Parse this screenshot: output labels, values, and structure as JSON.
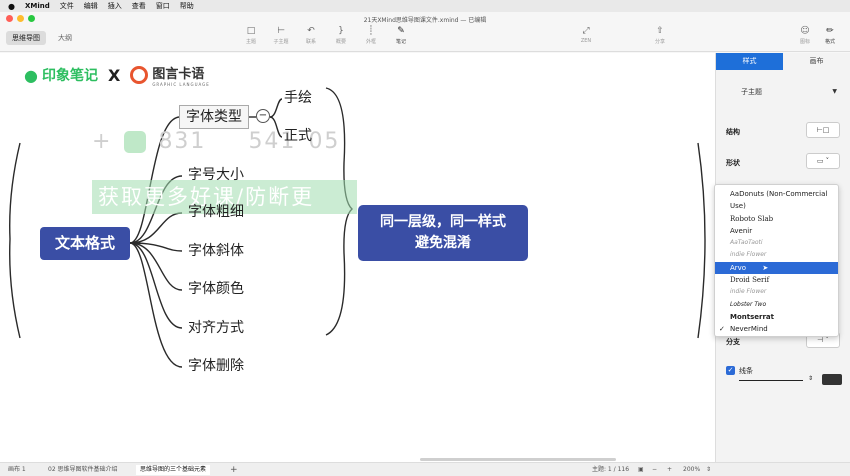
{
  "menubar": {
    "apple": "",
    "items": [
      "XMind",
      "文件",
      "编辑",
      "插入",
      "查看",
      "窗口",
      "帮助"
    ]
  },
  "window": {
    "title": "21天XMind思维导图课文件.xmind — 已编辑",
    "traffic_colors": [
      "#ff5f57",
      "#febc2e",
      "#28c840"
    ]
  },
  "view_tabs": [
    "思维导图",
    "大纲"
  ],
  "toolbar": {
    "topic": "主题",
    "subtopic": "子主题",
    "relation": "联系",
    "summary": "概要",
    "boundary": "外框",
    "note": "笔记",
    "zen": "ZEN",
    "share": "分享",
    "icon_btn": "图标",
    "format_btn": "格式"
  },
  "branding": {
    "evernote": "印象笔记",
    "x": "X",
    "tuyu": "图言卡语",
    "tuyu_sub": "GRAPHIC LANGUAGE"
  },
  "watermark": {
    "plus": "+",
    "digits_a": "831",
    "digits_b": "541",
    "digits_c": "05",
    "banner": "获取更多好课/防断更"
  },
  "mindmap": {
    "root": "文本格式",
    "branches": [
      "字体类型",
      "字号大小",
      "字体粗细",
      "字体斜体",
      "字体颜色",
      "对齐方式",
      "字体删除"
    ],
    "subbranches": [
      "手绘",
      "正式"
    ],
    "collapse_symbol": "−",
    "summary_line1": "同一层级，同一样式",
    "summary_line2": "避免混淆"
  },
  "panel": {
    "tabs": [
      "样式",
      "画布"
    ],
    "topic_select": "子主题",
    "structure_label": "结构",
    "shape_label": "形状",
    "branch_label": "分支",
    "line_label": "线条",
    "accent": "#1e6fd9"
  },
  "font_dropdown": {
    "items": [
      "AaDonuts (Non-Commercial",
      "Use)",
      "Roboto Slab",
      "Avenir",
      "AaTaoTaoti",
      "indie Flower",
      "Arvo",
      "Droid Serif",
      "indie Flower",
      "Lobster Two",
      "Montserrat",
      "NeverMind"
    ],
    "selected": "Arvo",
    "checked": "NeverMind"
  },
  "statusbar": {
    "sheets": [
      "画布 1",
      "02 思维导图软件基础介绍",
      "思维导图的三个基础元素"
    ],
    "add": "+",
    "topic_count": "主题: 1 / 116",
    "zoom": "200%"
  }
}
